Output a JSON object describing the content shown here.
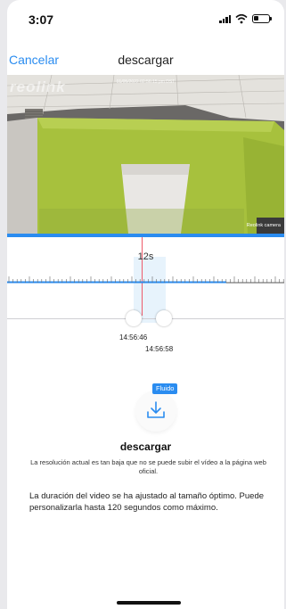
{
  "status": {
    "time": "3:07"
  },
  "nav": {
    "cancel": "Cancelar",
    "title": "descargar"
  },
  "video": {
    "logo": "reolink",
    "timestamp": "01/05/2022 02:56:15 pm DST",
    "camera_name": "Reolink camera"
  },
  "timeline": {
    "duration": "12s",
    "start_time": "14:56:46",
    "end_time": "14:56:58"
  },
  "download": {
    "badge": "Fluido",
    "title": "descargar",
    "message": "La resolución actual es tan baja que no se puede subir el vídeo a la página web oficial.",
    "note": "La duración del video se ha ajustado al tamaño óptimo. Puede personalizarla hasta 120 segundos como máximo."
  },
  "colors": {
    "accent": "#2a8cf0",
    "marker": "#ee5a6a"
  }
}
